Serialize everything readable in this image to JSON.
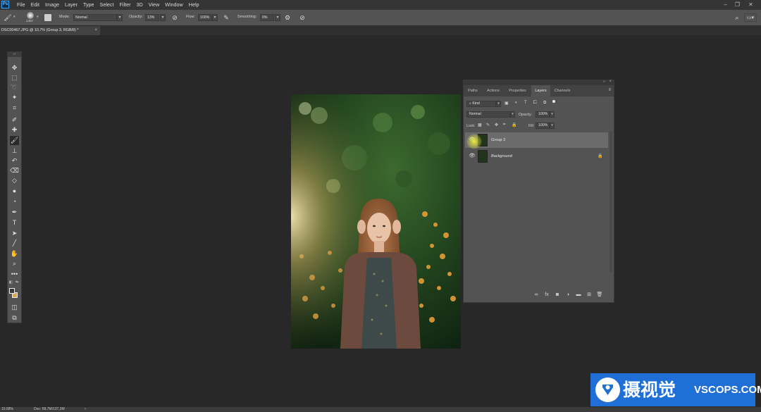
{
  "app": {
    "logo_text": "Ps"
  },
  "menu": [
    "File",
    "Edit",
    "Image",
    "Layer",
    "Type",
    "Select",
    "Filter",
    "3D",
    "View",
    "Window",
    "Help"
  ],
  "window_controls": {
    "minimize": "–",
    "restore": "❐",
    "close": "✕"
  },
  "options_bar": {
    "brush_size": "1457",
    "mode_label": "Mode:",
    "mode_value": "Normal",
    "opacity_label": "Opacity:",
    "opacity_value": "13%",
    "flow_label": "Flow:",
    "flow_value": "100%",
    "smoothing_label": "Smoothing:",
    "smoothing_value": "0%"
  },
  "document_tab": {
    "title": "DSC00467.JPG @ 10,7% (Group 3, RGB/8) *",
    "close": "×"
  },
  "layers_panel": {
    "tabs": [
      "Paths",
      "Actions",
      "Properties",
      "Layers",
      "Channels"
    ],
    "active_tab": "Layers",
    "filter_value": "Kind",
    "blend_mode": "Normal",
    "opacity_label": "Opacity:",
    "opacity_value": "100%",
    "lock_label": "Lock:",
    "fill_label": "Fill:",
    "fill_value": "100%",
    "layers": [
      {
        "name": "Group 3",
        "selected": true
      },
      {
        "name": "Background",
        "selected": false,
        "locked": true
      }
    ]
  },
  "status_bar": {
    "zoom": "10.68%",
    "doc": "Doc: 68,7M/137,3M"
  },
  "watermark": {
    "chinese": "摄视觉",
    "english": "VSCOPS.COM"
  },
  "colors": {
    "panel": "#535353",
    "workspace": "#282828",
    "selection": "#6b6b6b",
    "watermark": "#1f6fd6"
  }
}
